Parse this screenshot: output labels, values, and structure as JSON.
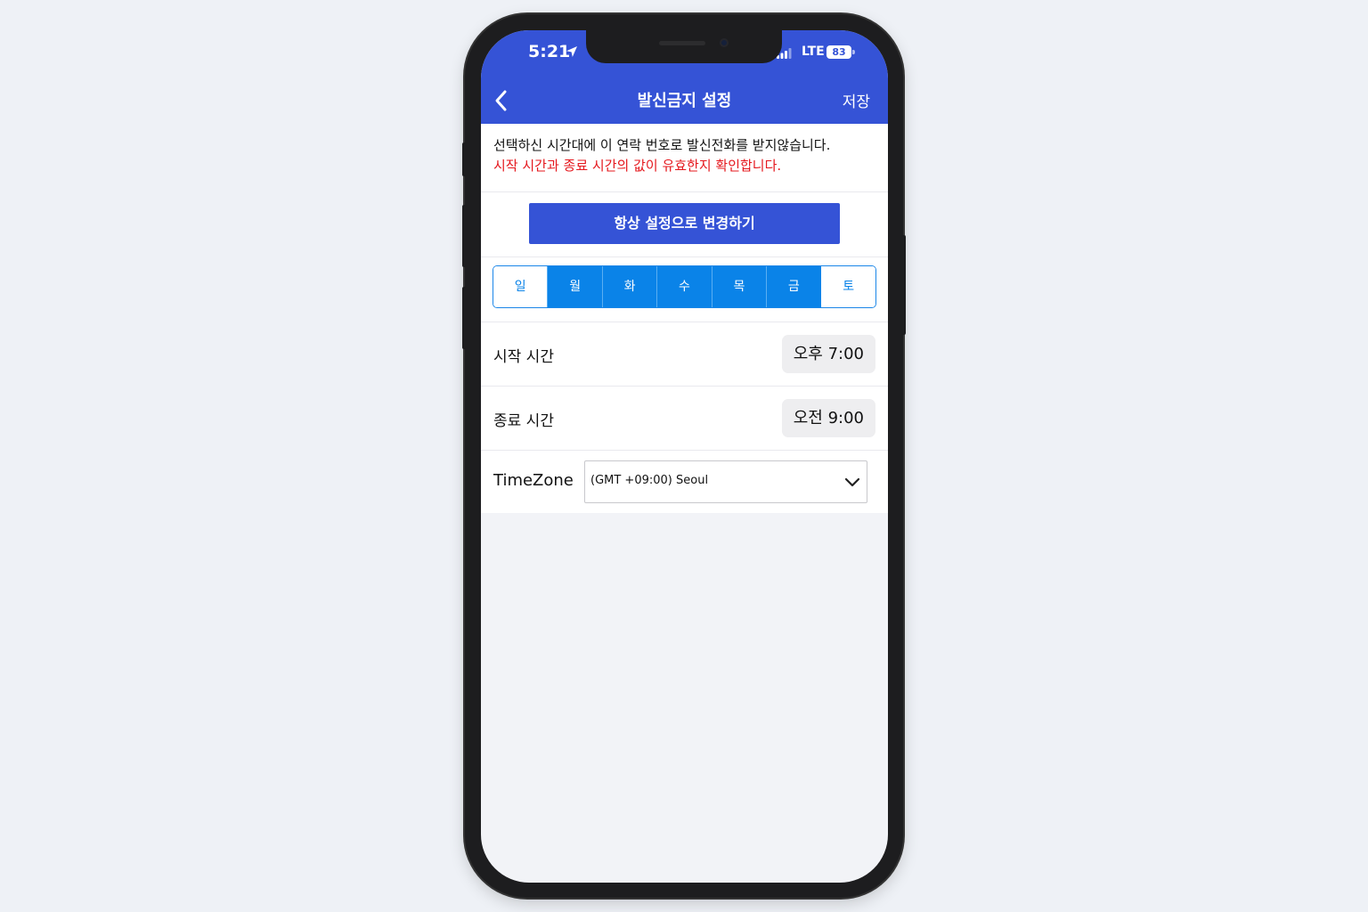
{
  "status_bar": {
    "time": "5:21",
    "network": "LTE",
    "battery": "83"
  },
  "nav": {
    "title": "발신금지 설정",
    "save_label": "저장",
    "back_icon": "chevron-left-icon"
  },
  "notice": {
    "line1": "선택하신 시간대에 이 연락 번호로 발신전화를 받지않습니다.",
    "line2": "시작 시간과 종료 시간의 값이 유효한지 확인합니다.",
    "warning_color": "#e5181e"
  },
  "always_button": {
    "label": "항상 설정으로 변경하기"
  },
  "days": [
    {
      "label": "일",
      "selected": false
    },
    {
      "label": "월",
      "selected": true
    },
    {
      "label": "화",
      "selected": true
    },
    {
      "label": "수",
      "selected": true
    },
    {
      "label": "목",
      "selected": true
    },
    {
      "label": "금",
      "selected": true
    },
    {
      "label": "토",
      "selected": false
    }
  ],
  "start_time": {
    "label": "시작 시간",
    "value": "오후 7:00"
  },
  "end_time": {
    "label": "종료 시간",
    "value": "오전 9:00"
  },
  "timezone": {
    "label": "TimeZone",
    "value": "(GMT +09:00) Seoul"
  },
  "colors": {
    "accent": "#3553d6",
    "day_selected": "#0a83e8"
  }
}
